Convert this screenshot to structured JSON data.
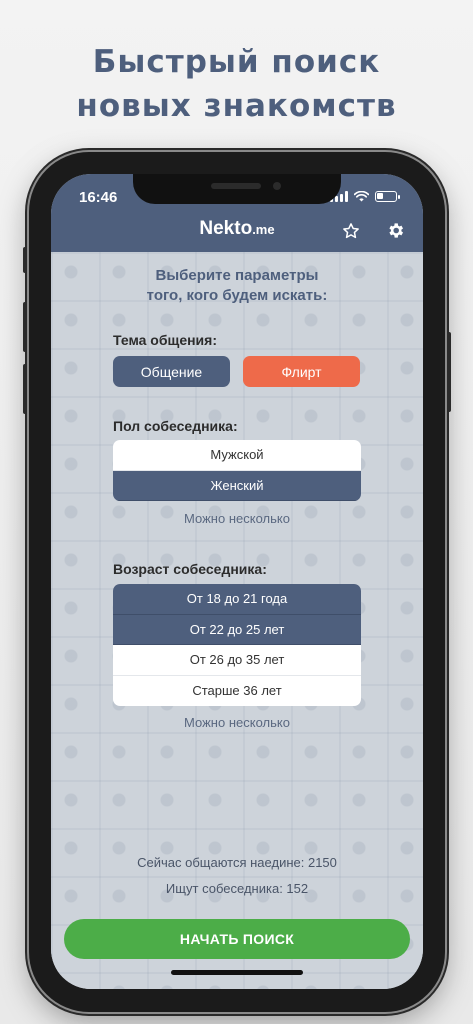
{
  "promo": {
    "line1": "Быстрый поиск",
    "line2": "новых знакомств"
  },
  "status_bar": {
    "time": "16:46"
  },
  "header": {
    "logo_main": "Nekto",
    "logo_suffix": ".me"
  },
  "icons": {
    "star": "star-icon",
    "settings": "gear-icon",
    "signal": "signal-icon",
    "wifi": "wifi-icon",
    "battery": "battery-icon"
  },
  "prompt": {
    "line1": "Выберите параметры",
    "line2": "того, кого будем искать:"
  },
  "topic": {
    "label": "Тема общения:",
    "options": [
      "Общение",
      "Флирт"
    ],
    "selected": "Флирт"
  },
  "gender": {
    "label": "Пол собеседника:",
    "options": [
      "Мужской",
      "Женский"
    ],
    "selected": [
      "Женский"
    ],
    "hint": "Можно несколько"
  },
  "age": {
    "label": "Возраст собеседника:",
    "options": [
      "От 18 до 21 года",
      "От 22 до 25 лет",
      "От 26 до 35 лет",
      "Старше 36 лет"
    ],
    "selected": [
      "От 18 до 21 года",
      "От 22 до 25 лет"
    ],
    "hint": "Можно несколько"
  },
  "stats": {
    "chatting_now": "Сейчас общаются наедине: 2150",
    "searching_now": "Ищут собеседника: 152"
  },
  "start_button": {
    "label": "НАЧАТЬ ПОИСК"
  },
  "colors": {
    "brand": "#4e5f7d",
    "accent": "#ee6a4a",
    "start": "#4cad48",
    "background": "#cdd3da"
  }
}
